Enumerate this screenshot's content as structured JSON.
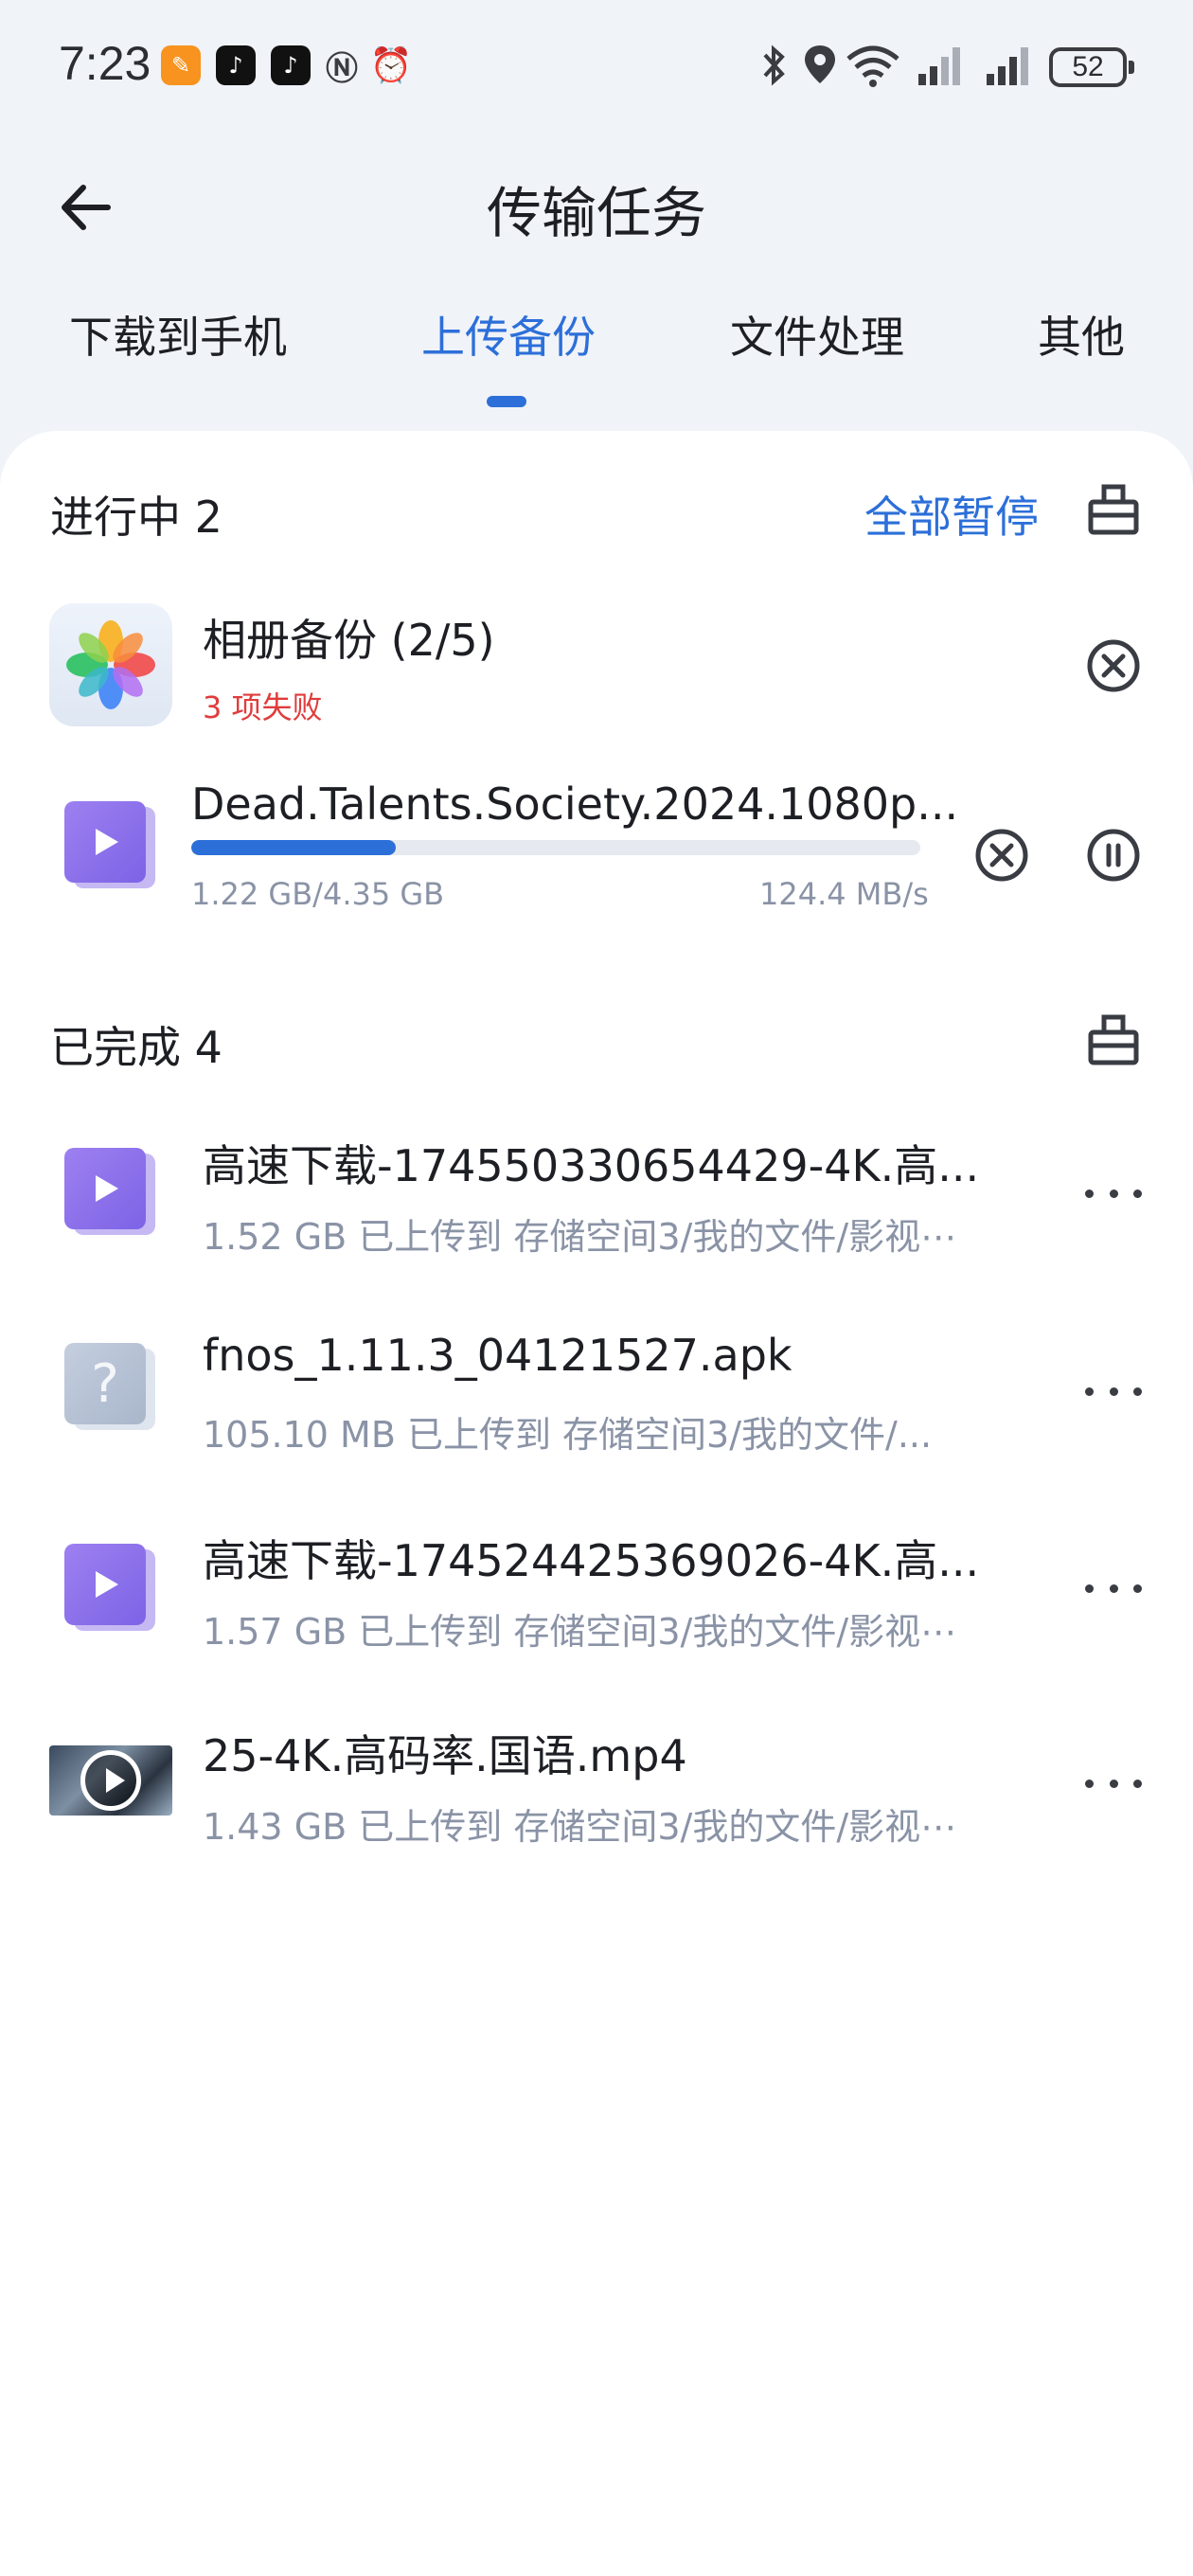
{
  "status_bar": {
    "time": "7:23",
    "battery": "52"
  },
  "header": {
    "title": "传输任务"
  },
  "tabs": [
    {
      "label": "下载到手机"
    },
    {
      "label": "上传备份"
    },
    {
      "label": "文件处理"
    },
    {
      "label": "其他"
    }
  ],
  "in_progress": {
    "title": "进行中 2",
    "pause_all": "全部暂停",
    "album_backup": {
      "title": "相册备份 (2/5)",
      "failed": "3 项失败"
    },
    "upload_item": {
      "name": "Dead.Talents.Society.2024.1080p...",
      "size": "1.22 GB/4.35 GB",
      "speed": "124.4 MB/s",
      "progress": 0.28
    }
  },
  "completed": {
    "title": "已完成 4",
    "items": [
      {
        "name": "高速下载-174550330654429-4K.高...",
        "detail": "1.52 GB 已上传到 存储空间3/我的文件/影视⋯",
        "icon": "video-file-icon"
      },
      {
        "name": "fnos_1.11.3_04121527.apk",
        "detail": "105.10 MB 已上传到 存储空间3/我的文件/...",
        "icon": "unknown-file-icon"
      },
      {
        "name": "高速下载-174524425369026-4K.高...",
        "detail": "1.57 GB 已上传到 存储空间3/我的文件/影视⋯",
        "icon": "video-file-icon"
      },
      {
        "name": "25-4K.高码率.国语.mp4",
        "detail": "1.43 GB 已上传到 存储空间3/我的文件/影视⋯",
        "icon": "video-thumbnail"
      }
    ]
  },
  "colors": {
    "accent": "#2c6fd9",
    "error": "#e03c3c",
    "background": "#f0f3f8"
  }
}
